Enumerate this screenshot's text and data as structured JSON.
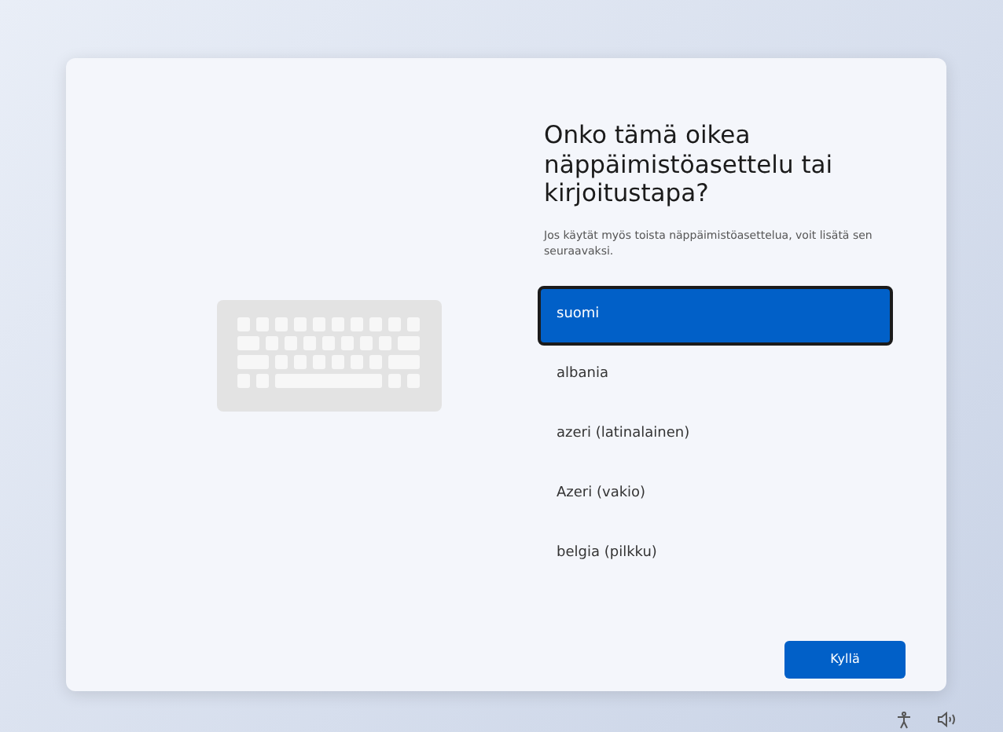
{
  "title": "Onko tämä oikea näppäimistöasettelu tai kirjoitustapa?",
  "subtitle": "Jos käytät myös toista näppäimistöasettelua, voit lisätä sen seuraavaksi.",
  "layouts": [
    {
      "label": "suomi",
      "selected": true
    },
    {
      "label": "albania",
      "selected": false
    },
    {
      "label": "azeri (latinalainen)",
      "selected": false
    },
    {
      "label": "Azeri (vakio)",
      "selected": false
    },
    {
      "label": "belgia (pilkku)",
      "selected": false
    }
  ],
  "primary_button": "Kyllä"
}
